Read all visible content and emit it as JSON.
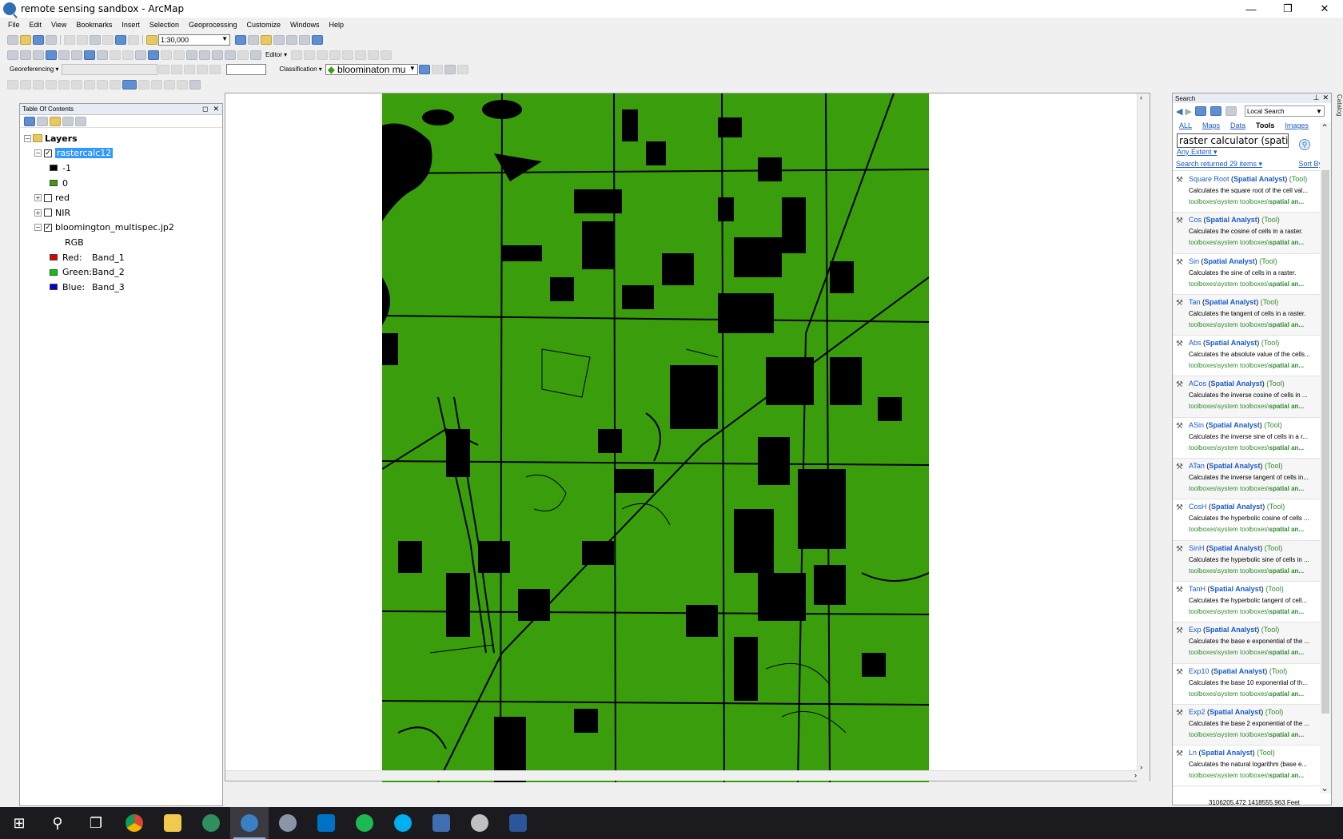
{
  "window": {
    "title": "remote sensing sandbox - ArcMap",
    "minimize": "—",
    "restore": "❐",
    "close": "✕"
  },
  "menu": [
    "File",
    "Edit",
    "View",
    "Bookmarks",
    "Insert",
    "Selection",
    "Geoprocessing",
    "Customize",
    "Windows",
    "Help"
  ],
  "toolbar": {
    "scale": "1:30,000",
    "editor_label": "Editor ▾",
    "georeferencing_label": "Georeferencing ▾",
    "classification_label": "Classification ▾",
    "layer_combo": "bloominaton mu"
  },
  "toc": {
    "title": "Table Of Contents",
    "root": "Layers",
    "layers": [
      {
        "name": "rastercalc12",
        "checked": true,
        "expanded": true,
        "selected": true
      },
      {
        "name": "red",
        "checked": false,
        "expanded": false
      },
      {
        "name": "NIR",
        "checked": false,
        "expanded": false
      },
      {
        "name": "bloomington_multispec.jp2",
        "checked": true,
        "expanded": true
      }
    ],
    "legend_rastercalc": [
      {
        "label": "-1",
        "color": "#000000"
      },
      {
        "label": "0",
        "color": "#3a9e0c"
      }
    ],
    "rgb_label": "RGB",
    "bands": [
      {
        "channel": "Red:",
        "band": "Band_1",
        "color": "#e00000"
      },
      {
        "channel": "Green:",
        "band": "Band_2",
        "color": "#00cc00"
      },
      {
        "channel": "Blue:",
        "band": "Band_3",
        "color": "#0000d0"
      }
    ]
  },
  "search": {
    "title": "Search",
    "scope": "Local Search",
    "tabs": [
      "ALL",
      "Maps",
      "Data",
      "Tools",
      "Images"
    ],
    "active_tab": "Tools",
    "query": "raster calculator (spatia",
    "extent": "Any Extent ▾",
    "summary": "Search returned 29 items ▾",
    "sort": "Sort By ▾",
    "results": [
      {
        "name": "Square Root",
        "desc": "Calculates the square root of the cell val...",
        "path_prefix": "toolboxes\\system toolboxes\\",
        "path_bold": "spatial an..."
      },
      {
        "name": "Cos",
        "desc": "Calculates the cosine of cells in a raster.",
        "path_prefix": "toolboxes\\system toolboxes\\",
        "path_bold": "spatial an..."
      },
      {
        "name": "Sin",
        "desc": "Calculates the sine of cells in a raster.",
        "path_prefix": "toolboxes\\system toolboxes\\",
        "path_bold": "spatial an..."
      },
      {
        "name": "Tan",
        "desc": "Calculates the tangent of cells in a raster.",
        "path_prefix": "toolboxes\\system toolboxes\\",
        "path_bold": "spatial an..."
      },
      {
        "name": "Abs",
        "desc": "Calculates the absolute value of the cells...",
        "path_prefix": "toolboxes\\system toolboxes\\",
        "path_bold": "spatial an..."
      },
      {
        "name": "ACos",
        "desc": "Calculates the inverse cosine of cells in ...",
        "path_prefix": "toolboxes\\system toolboxes\\",
        "path_bold": "spatial an..."
      },
      {
        "name": "ASin",
        "desc": "Calculates the inverse sine of cells in a r...",
        "path_prefix": "toolboxes\\system toolboxes\\",
        "path_bold": "spatial an..."
      },
      {
        "name": "ATan",
        "desc": "Calculates the inverse tangent of cells in...",
        "path_prefix": "toolboxes\\system toolboxes\\",
        "path_bold": "spatial an..."
      },
      {
        "name": "CosH",
        "desc": "Calculates the hyperbolic cosine of cells ...",
        "path_prefix": "toolboxes\\system toolboxes\\",
        "path_bold": "spatial an..."
      },
      {
        "name": "SinH",
        "desc": "Calculates the hyperbolic sine of cells in ...",
        "path_prefix": "toolboxes\\system toolboxes\\",
        "path_bold": "spatial an..."
      },
      {
        "name": "TanH",
        "desc": "Calculates the hyperbolic tangent of cell...",
        "path_prefix": "toolboxes\\system toolboxes\\",
        "path_bold": "spatial an..."
      },
      {
        "name": "Exp",
        "desc": "Calculates the base e exponential of the ...",
        "path_prefix": "toolboxes\\system toolboxes\\",
        "path_bold": "spatial an..."
      },
      {
        "name": "Exp10",
        "desc": "Calculates the base 10 exponential of th...",
        "path_prefix": "toolboxes\\system toolboxes\\",
        "path_bold": "spatial an..."
      },
      {
        "name": "Exp2",
        "desc": "Calculates the base 2 exponential of the ...",
        "path_prefix": "toolboxes\\system toolboxes\\",
        "path_bold": "spatial an..."
      },
      {
        "name": "Ln",
        "desc": "Calculates the natural logarithm (base e...",
        "path_prefix": "toolboxes\\system toolboxes\\",
        "path_bold": "spatial an..."
      }
    ],
    "tool_category": "Spatial Analyst",
    "tool_type": "(Tool)",
    "catalog_tab": "Catalog"
  },
  "status": {
    "coords": "3106205.472  1418555.963 Feet"
  },
  "taskbar": [
    "windows-start",
    "search",
    "task-view",
    "chrome",
    "file-explorer",
    "globe-app",
    "arcmap",
    "r-studio",
    "outlook",
    "spotify",
    "skype",
    "matlab",
    "paint-app",
    "word"
  ]
}
